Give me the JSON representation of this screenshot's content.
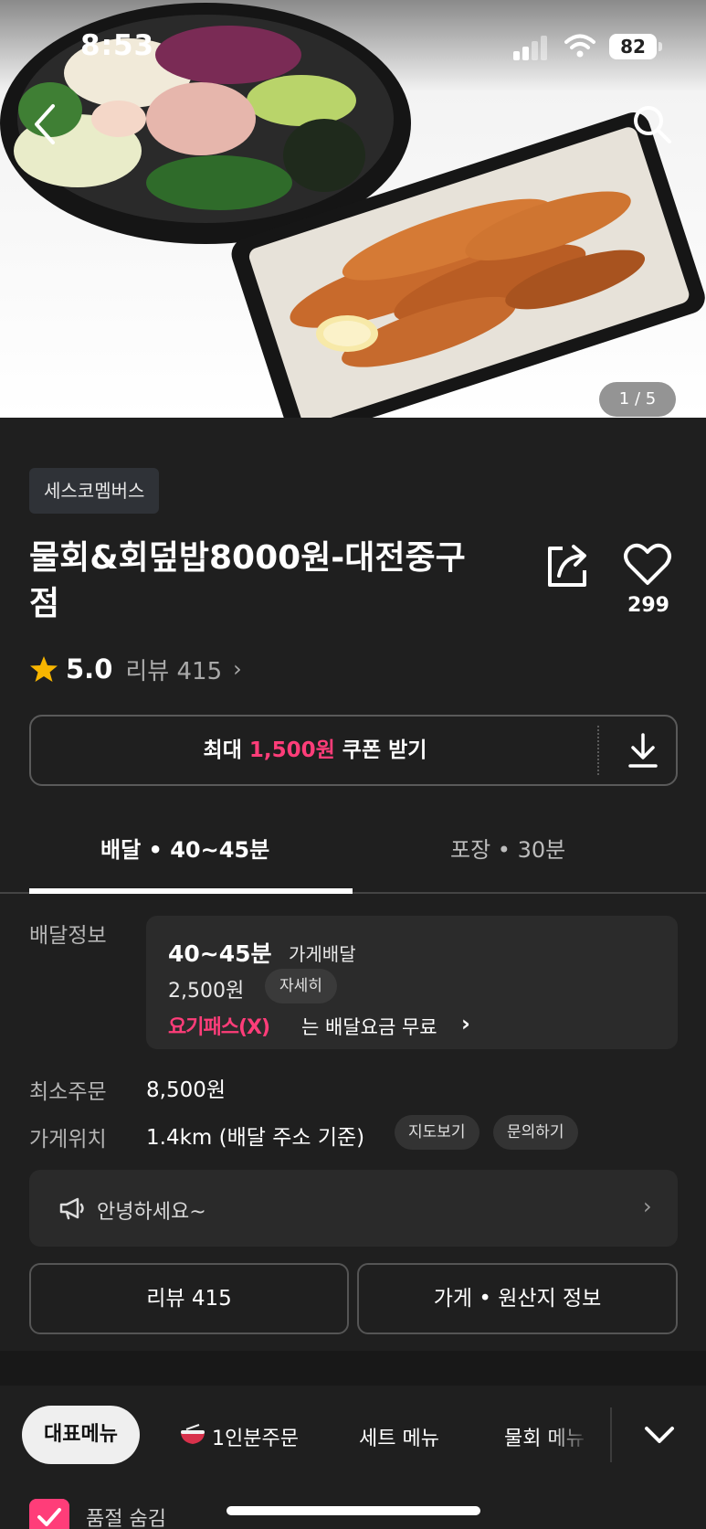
{
  "status_bar": {
    "time": "8:53",
    "battery": "82"
  },
  "hero": {
    "image_counter": "1 / 5"
  },
  "store": {
    "tag": "세스코멤버스",
    "name": "물회&회덮밥8000원-대전중구점",
    "likes": "299",
    "rating": "5.0",
    "review_label": "리뷰 415"
  },
  "coupon": {
    "prefix": "최대 ",
    "amount": "1,500원",
    "suffix": " 쿠폰 받기"
  },
  "tabs": {
    "delivery": "배달 • 40~45분",
    "pickup": "포장 • 30분"
  },
  "delivery_info": {
    "label": "배달정보",
    "time": "40~45분",
    "type": "가게배달",
    "fee": "2,500원",
    "detail_label": "자세히",
    "pass_logo": "요기패스(X)",
    "pass_text": "는 배달요금 무료"
  },
  "min_order": {
    "label": "최소주문",
    "value": "8,500원"
  },
  "location": {
    "label": "가게위치",
    "value": "1.4km (배달 주소 기준)",
    "map_label": "지도보기",
    "inquiry_label": "문의하기"
  },
  "notice": {
    "text": "안녕하세요~"
  },
  "buttons": {
    "reviews": "리뷰 415",
    "store_info": "가게 • 원산지 정보"
  },
  "categories": [
    "대표메뉴",
    "1인분주문",
    "세트 메뉴",
    "물회 메뉴"
  ],
  "soldout": {
    "label": "품절 숨김"
  },
  "colors": {
    "accent": "#ff3d79",
    "background": "#1f1f1f",
    "star": "#f7b500"
  },
  "icons": [
    "back-icon",
    "search-icon",
    "share-icon",
    "heart-icon",
    "star-icon",
    "download-icon",
    "megaphone-icon",
    "bowl-icon",
    "chevron-down-icon",
    "check-icon"
  ]
}
